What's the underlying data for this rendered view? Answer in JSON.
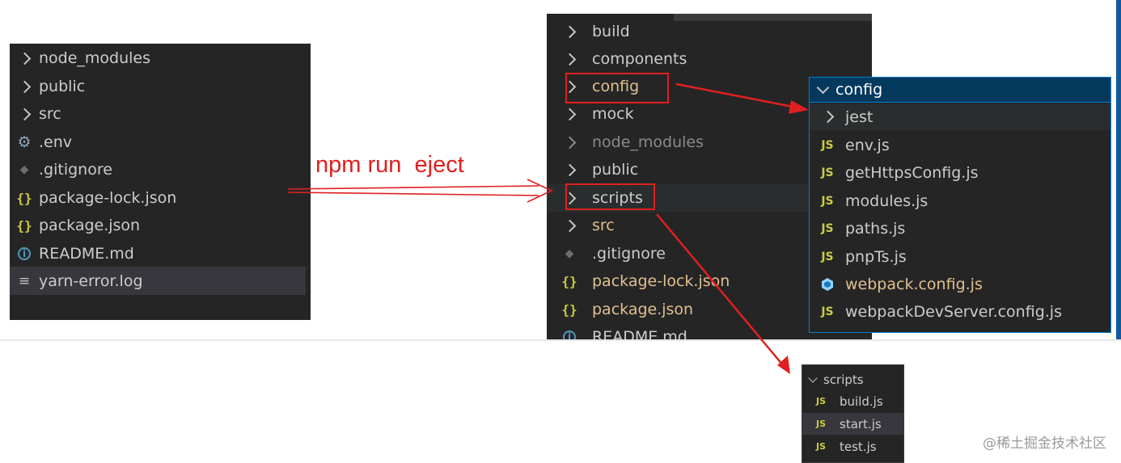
{
  "left_explorer": {
    "items": [
      {
        "label": "node_modules",
        "icon": "chevron-right-icon"
      },
      {
        "label": "public",
        "icon": "chevron-right-icon"
      },
      {
        "label": "src",
        "icon": "chevron-right-icon"
      },
      {
        "label": ".env",
        "icon": "gear-icon"
      },
      {
        "label": ".gitignore",
        "icon": "git-diamond-icon"
      },
      {
        "label": "package-lock.json",
        "icon": "json-braces-icon"
      },
      {
        "label": "package.json",
        "icon": "json-braces-icon"
      },
      {
        "label": "README.md",
        "icon": "info-icon"
      },
      {
        "label": "yarn-error.log",
        "icon": "lines-icon"
      }
    ]
  },
  "annotation": {
    "command": "npm run  eject"
  },
  "middle_explorer": {
    "items": [
      {
        "label": "build",
        "icon": "chevron-right-icon"
      },
      {
        "label": "components",
        "icon": "chevron-right-icon"
      },
      {
        "label": "config",
        "icon": "chevron-right-icon"
      },
      {
        "label": "mock",
        "icon": "chevron-right-icon"
      },
      {
        "label": "node_modules",
        "icon": "chevron-right-icon"
      },
      {
        "label": "public",
        "icon": "chevron-right-icon"
      },
      {
        "label": "scripts",
        "icon": "chevron-right-icon"
      },
      {
        "label": "src",
        "icon": "chevron-right-icon"
      },
      {
        "label": ".gitignore",
        "icon": "git-diamond-icon"
      },
      {
        "label": "package-lock.json",
        "icon": "json-braces-icon"
      },
      {
        "label": "package.json",
        "icon": "json-braces-icon"
      },
      {
        "label": "README.md",
        "icon": "info-icon"
      }
    ]
  },
  "config_panel": {
    "header": "config",
    "js_badge": "JS",
    "items": [
      {
        "label": "jest",
        "icon": "chevron-right-icon"
      },
      {
        "label": "env.js",
        "icon": "js-icon"
      },
      {
        "label": "getHttpsConfig.js",
        "icon": "js-icon"
      },
      {
        "label": "modules.js",
        "icon": "js-icon"
      },
      {
        "label": "paths.js",
        "icon": "js-icon"
      },
      {
        "label": "pnpTs.js",
        "icon": "js-icon"
      },
      {
        "label": "webpack.config.js",
        "icon": "webpack-cube-icon"
      },
      {
        "label": "webpackDevServer.config.js",
        "icon": "js-icon"
      }
    ]
  },
  "scripts_panel": {
    "header": "scripts",
    "js_badge": "JS",
    "items": [
      {
        "label": "build.js",
        "icon": "js-icon"
      },
      {
        "label": "start.js",
        "icon": "js-icon"
      },
      {
        "label": "test.js",
        "icon": "js-icon"
      }
    ]
  },
  "watermark": "@稀土掘金技术社区",
  "colors": {
    "panel_bg": "#252526",
    "selection_bg": "#37373d",
    "focus_border": "#007fd4",
    "annotation_red": "#e02020",
    "js_yellow": "#cbcb41",
    "modified_yellow": "#e2c08d"
  }
}
